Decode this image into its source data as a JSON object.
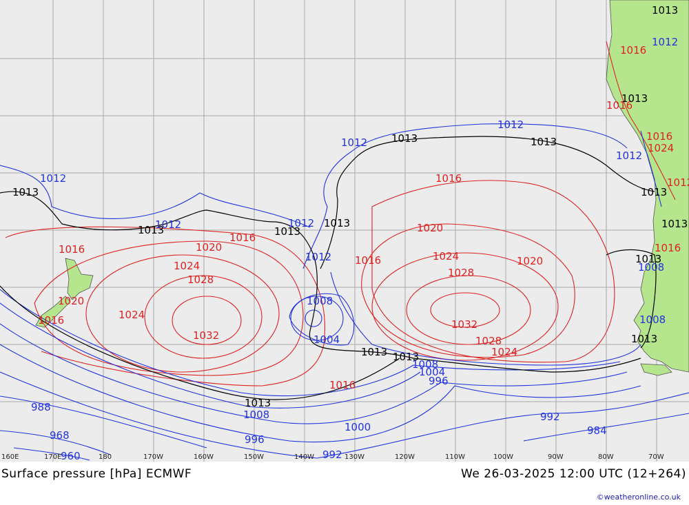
{
  "map": {
    "colors": {
      "ocean": "#ececec",
      "land": "#b5e58c",
      "grid": "#a9a9a9",
      "low_isobar": "#2233dd",
      "high_isobar": "#dd2222",
      "reference_isobar": "#000000"
    },
    "longitude_labels": [
      "160E",
      "170E",
      "180",
      "170W",
      "160W",
      "150W",
      "140W",
      "130W",
      "120W",
      "110W",
      "100W",
      "90W",
      "80W",
      "70W"
    ],
    "isobar_labels": {
      "blue": [
        "1012",
        "1012",
        "1012",
        "1012",
        "1012",
        "1012",
        "1012",
        "1008",
        "1004",
        "1008",
        "1008",
        "1004",
        "996",
        "988",
        "968",
        "960",
        "1008",
        "996",
        "1000",
        "992",
        "992",
        "984",
        "1012",
        "1008"
      ],
      "red": [
        "1016",
        "1020",
        "1016",
        "1020",
        "1024",
        "1028",
        "1032",
        "1024",
        "1016",
        "1016",
        "1020",
        "1024",
        "1028",
        "1032",
        "1028",
        "1024",
        "1020",
        "1016",
        "1016",
        "1016",
        "1024",
        "1012",
        "1016",
        "1016",
        "1016"
      ],
      "black": [
        "1013",
        "1013",
        "1013",
        "1013",
        "1013",
        "1013",
        "1013",
        "1013",
        "1013",
        "1013",
        "1013",
        "1013",
        "1013",
        "1013",
        "1013"
      ]
    }
  },
  "footer": {
    "title": "Surface pressure [hPa] ECMWF",
    "valid_time": "We 26-03-2025 12:00 UTC (12+264)",
    "credit": "©weatheronline.co.uk"
  }
}
